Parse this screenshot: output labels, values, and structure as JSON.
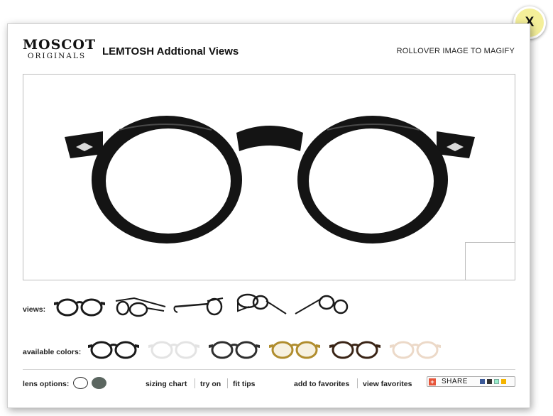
{
  "close": {
    "label": "X"
  },
  "logo": {
    "line1": "MOSCOT",
    "line2": "ORIGINALS"
  },
  "header": {
    "title": "LEMTOSH Addtional Views",
    "hint": "ROLLOVER IMAGE TO MAGIFY"
  },
  "views": {
    "label": "views:",
    "items": [
      "front-view",
      "angle-view",
      "side-view",
      "back-angle-view",
      "perspective-view"
    ]
  },
  "colors": {
    "label": "available colors:",
    "items": [
      {
        "name": "black",
        "frame": "#1a1a1a",
        "lens": "#ffffff"
      },
      {
        "name": "crystal",
        "frame": "#e3e3e3",
        "lens": "#ffffff"
      },
      {
        "name": "grey",
        "frame": "#2f2f2f",
        "lens": "#ffffff"
      },
      {
        "name": "honey",
        "frame": "#b08d2e",
        "lens": "#f7f1e0"
      },
      {
        "name": "tortoise",
        "frame": "#3a2416",
        "lens": "#ffffff"
      },
      {
        "name": "blonde",
        "frame": "#ecd9c8",
        "lens": "#ffffff"
      }
    ]
  },
  "lens": {
    "label": "lens options:",
    "options": [
      {
        "name": "clear",
        "color": "#ffffff"
      },
      {
        "name": "grey",
        "color": "#5b6660"
      }
    ]
  },
  "links": {
    "sizing": "sizing chart",
    "tryon": "try on",
    "fittips": "fit tips",
    "addfav": "add to favorites",
    "viewfav": "view favorites"
  },
  "share": {
    "label": "SHARE"
  }
}
